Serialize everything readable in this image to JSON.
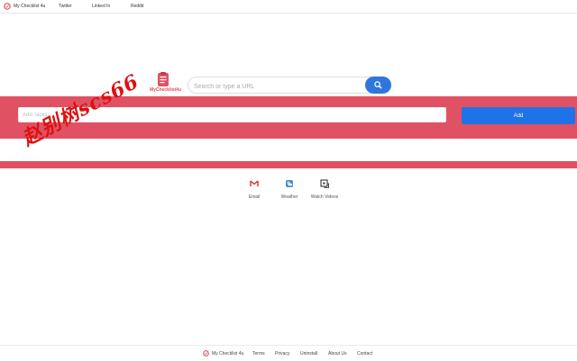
{
  "topnav": {
    "brand": "My Checklist 4u",
    "links": [
      "Twitter",
      "Linked In",
      "Reddit"
    ]
  },
  "brand": {
    "name": "MyChecklist4u",
    "icon": "checklist-logo-icon"
  },
  "search": {
    "placeholder": "Search or type a URL",
    "button_icon": "search-icon"
  },
  "tasks": {
    "placeholder": "Add Tasks",
    "add_label": "Add"
  },
  "shortcuts": [
    {
      "label": "Email",
      "icon": "gmail-icon"
    },
    {
      "label": "Weather",
      "icon": "weather-icon"
    },
    {
      "label": "Watch Videos",
      "icon": "video-icon"
    }
  ],
  "watermark": "赵别树scs66",
  "footer": {
    "brand": "My Checklist 4u",
    "links": [
      "Terms",
      "Privacy",
      "Uninstall",
      "About Us",
      "Contact"
    ]
  },
  "colors": {
    "accent_red": "#e05263",
    "accent_blue": "#1e73e8"
  }
}
